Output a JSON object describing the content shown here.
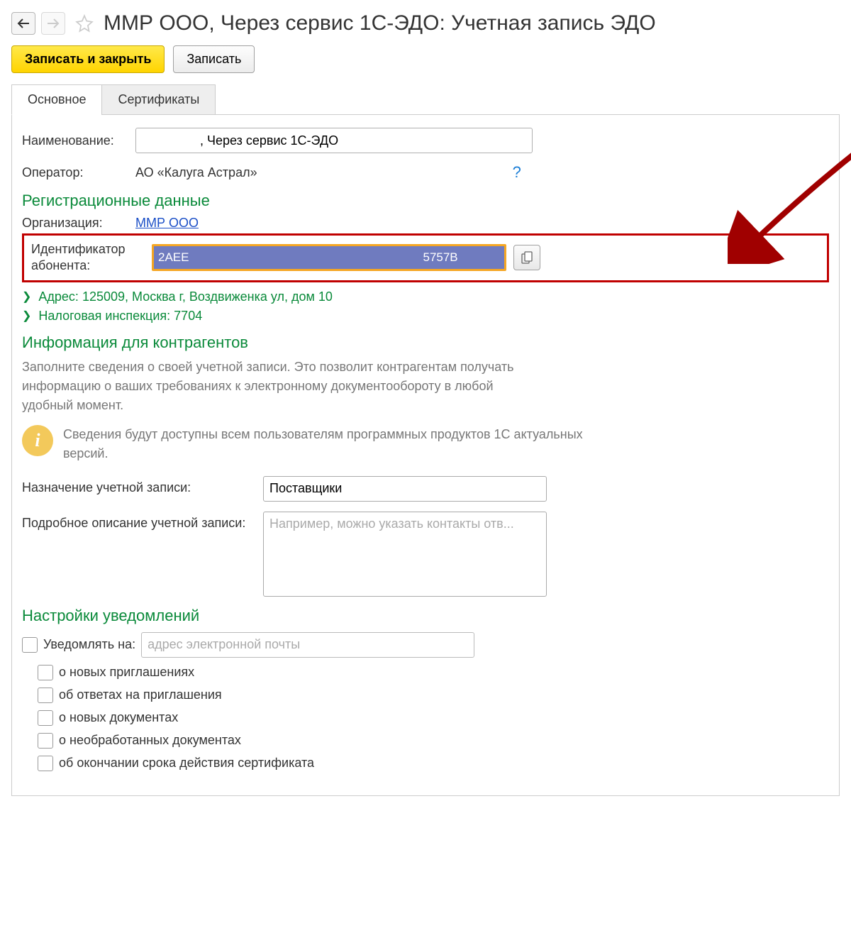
{
  "header": {
    "title": "ММР ООО, Через сервис 1С-ЭДО: Учетная запись ЭДО"
  },
  "toolbar": {
    "save_close": "Записать и закрыть",
    "save": "Записать"
  },
  "tabs": {
    "main": "Основное",
    "certs": "Сертификаты"
  },
  "main": {
    "name_label": "Наименование:",
    "name_value": ", Через сервис 1С-ЭДО",
    "operator_label": "Оператор:",
    "operator_value": "АО «Калуга Астрал»",
    "help_symbol": "?",
    "reg_heading": "Регистрационные данные",
    "org_label": "Организация:",
    "org_value": "ММР ООО",
    "subscriber_id_label_l1": "Идентификатор",
    "subscriber_id_label_l2": "абонента:",
    "id_left": "2AEE",
    "id_right": "5757B",
    "address": "Адрес: 125009, Москва г, Воздвиженка ул, дом 10",
    "tax": "Налоговая инспекция: 7704",
    "counterparty_heading": "Информация для контрагентов",
    "counterparty_desc": "Заполните сведения о своей учетной записи. Это позволит контрагентам получать информацию о ваших требованиях к электронному документообороту в любой удобный момент.",
    "info_note": "Сведения будут доступны всем пользователям программных продуктов 1С актуальных версий.",
    "purpose_label": "Назначение учетной записи:",
    "purpose_value": "Поставщики",
    "detail_label": "Подробное описание учетной записи:",
    "detail_placeholder": "Например, можно указать контакты отв...",
    "notify_heading": "Настройки уведомлений",
    "notify_on_label": "Уведомлять на:",
    "notify_email_placeholder": "адрес электронной почты",
    "checks": {
      "c1": "о новых приглашениях",
      "c2": "об ответах на приглашения",
      "c3": "о новых документах",
      "c4": "о необработанных документах",
      "c5": "об окончании срока действия сертификата"
    }
  }
}
